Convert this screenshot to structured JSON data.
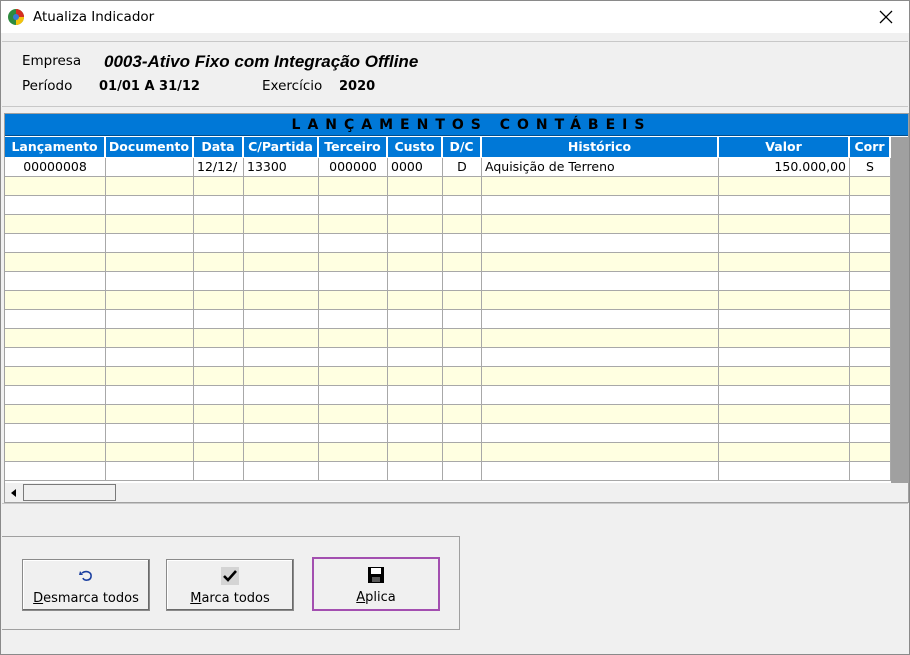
{
  "window": {
    "title": "Atualiza Indicador"
  },
  "header": {
    "empresa_label": "Empresa",
    "empresa_value": "0003-Ativo Fixo com Integração Offline",
    "periodo_label": "Período",
    "periodo_value": "01/01 A 31/12",
    "exercicio_label": "Exercício",
    "exercicio_value": "2020"
  },
  "grid": {
    "banner": "LANÇAMENTOS CONTÁBEIS",
    "columns": [
      "Lançamento",
      "Documento",
      "Data",
      "C/Partida",
      "Terceiro",
      "Custo",
      "D/C",
      "Histórico",
      "Valor",
      "Corr"
    ],
    "rows": [
      [
        "00000008",
        "",
        "12/12/",
        "13300",
        "000000",
        "0000",
        "D",
        "Aquisição de Terreno",
        "150.000,00",
        "S"
      ]
    ],
    "total_visible_rows": 17
  },
  "buttons": {
    "desmarca_mnemonic": "D",
    "desmarca_rest": "esmarca todos",
    "marca_mnemonic": "M",
    "marca_rest": "arca todos",
    "aplica_mnemonic": "A",
    "aplica_rest": "plica"
  },
  "colors": {
    "header_blue": "#0078d7",
    "row_alt": "#ffffe1",
    "focus_border": "#a34fb0"
  }
}
